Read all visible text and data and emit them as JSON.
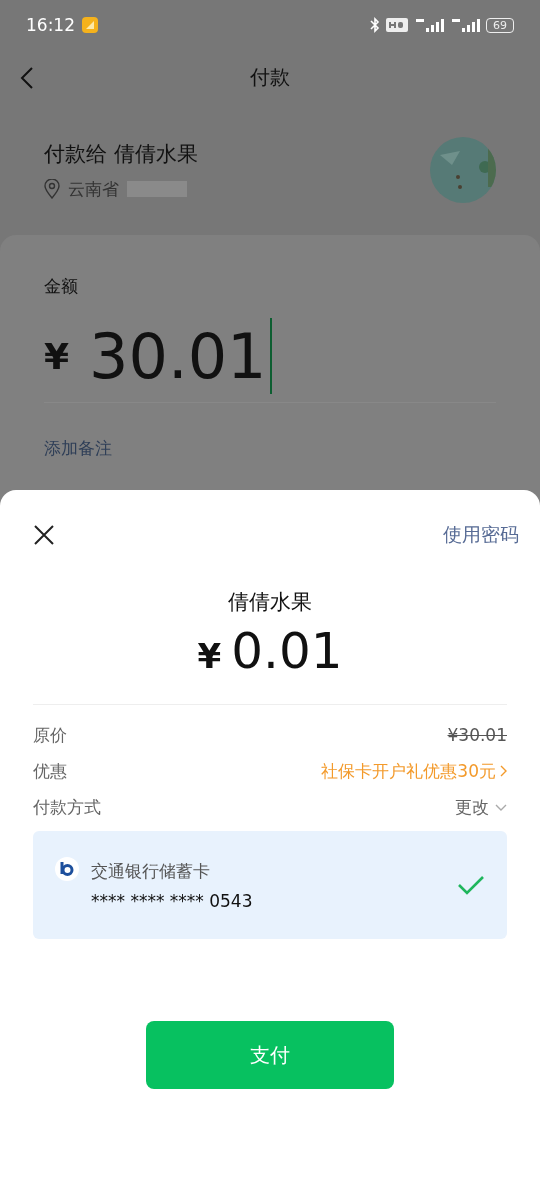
{
  "status_bar": {
    "time": "16:12",
    "battery": "69"
  },
  "nav": {
    "title": "付款"
  },
  "merchant": {
    "title": "付款给 倩倩水果",
    "address": "云南省"
  },
  "amount_card": {
    "label": "金额",
    "currency": "¥",
    "value": "30.01",
    "note_link": "添加备注"
  },
  "sheet": {
    "use_password": "使用密码",
    "merchant": "倩倩水果",
    "currency": "¥",
    "amount": "0.01",
    "rows": [
      {
        "kind": "strike",
        "label": "原价",
        "value": "¥30.01"
      },
      {
        "kind": "promo",
        "label": "优惠",
        "value": "社保卡开户礼优惠30元"
      },
      {
        "kind": "change",
        "label": "付款方式",
        "value": "更改"
      }
    ],
    "cards": [
      {
        "name": "交通银行储蓄卡",
        "number": "**** **** **** 0543",
        "selected": true
      }
    ],
    "pay_button": "支付"
  }
}
